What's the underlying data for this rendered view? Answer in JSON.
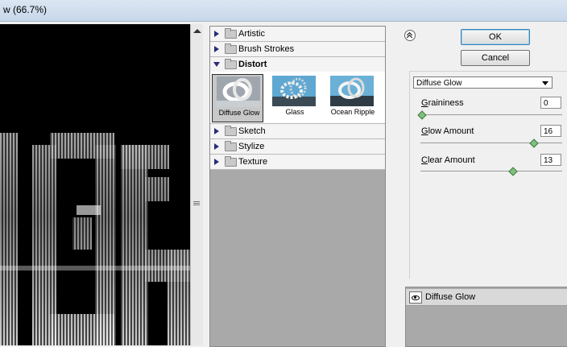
{
  "window": {
    "title": "w (66.7%)"
  },
  "gallery": {
    "categories": [
      {
        "label": "Artistic",
        "open": false
      },
      {
        "label": "Brush Strokes",
        "open": false
      },
      {
        "label": "Distort",
        "open": true
      },
      {
        "label": "Sketch",
        "open": false
      },
      {
        "label": "Stylize",
        "open": false
      },
      {
        "label": "Texture",
        "open": false
      }
    ],
    "filters": [
      {
        "label": "Diffuse Glow",
        "selected": true
      },
      {
        "label": "Glass",
        "selected": false
      },
      {
        "label": "Ocean Ripple",
        "selected": false
      }
    ]
  },
  "buttons": {
    "ok": "OK",
    "cancel": "Cancel"
  },
  "filter_select": {
    "value": "Diffuse Glow"
  },
  "params": [
    {
      "label": "Graininess",
      "accel": "G",
      "rest": "raininess",
      "value": "0",
      "max": 10
    },
    {
      "label": "Glow Amount",
      "accel": "G",
      "rest": "low Amount",
      "value": "16",
      "max": 20
    },
    {
      "label": "Clear Amount",
      "accel": "C",
      "rest": "lear Amount",
      "value": "13",
      "max": 20
    }
  ],
  "layers": [
    {
      "label": "Diffuse Glow"
    }
  ],
  "colors": {
    "panel": "#f0f0f0",
    "gallery_bg": "#a9a9a9",
    "preview_bg": "#000000",
    "accent": "#3c7fb1"
  }
}
